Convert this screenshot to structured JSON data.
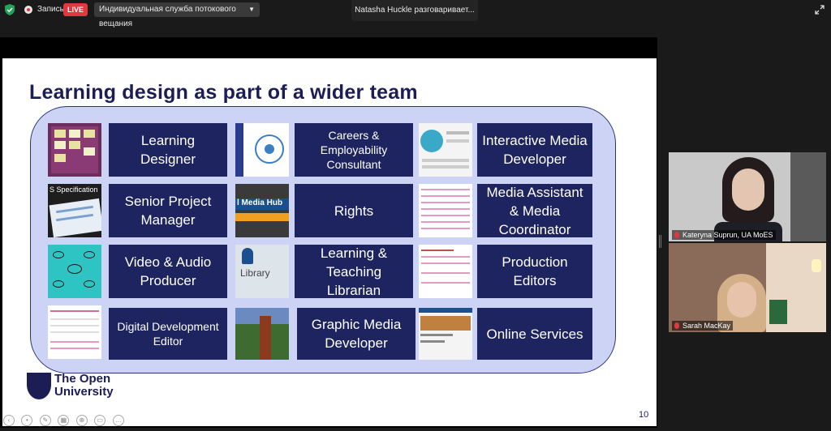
{
  "topbar": {
    "record_label": "Запись",
    "live_label": "LIVE",
    "stream_service": "Индивидуальная служба потокового вещания",
    "active_speaker": "Natasha Huckle разговаривает..."
  },
  "slide": {
    "title": "Learning design as part of a wider team",
    "number": "10",
    "logo_line1": "The Open",
    "logo_line2": "University",
    "thumb_texts": {
      "spec": "S Specification",
      "media_hub": "l Media Hub",
      "library": "Library"
    },
    "roles": [
      "Learning Designer",
      "Careers & Employability Consultant",
      "Interactive Media Developer",
      "Senior Project Manager",
      "Rights",
      "Media Assistant & Media Coordinator",
      "Video & Audio Producer",
      "Learning & Teaching Librarian",
      "Production Editors",
      "Digital Development Editor",
      "Graphic Media Developer",
      "Online Services"
    ]
  },
  "participants": [
    {
      "name": "Kateryna Suprun, UA MoES"
    },
    {
      "name": "Sarah MacKay"
    }
  ],
  "colors": {
    "tile": "#1d2460",
    "panel": "#cdd3f4",
    "title": "#1d1d56",
    "live": "#e0383e"
  }
}
